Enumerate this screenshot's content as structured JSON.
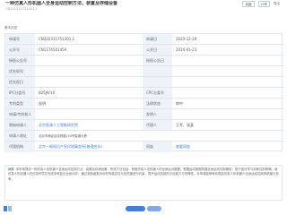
{
  "header": {
    "title": "一种仿真人形机器人全身运动控制方法、装置及存储设备",
    "subtitle": "CN202311751201.1",
    "actions": [
      "收藏",
      "分享",
      "导出"
    ]
  },
  "section": {
    "title": "基本信息"
  },
  "rows": [
    {
      "l1": "申请号",
      "v1": "CN202311751201.1",
      "l2": "申请日",
      "v2": "2023-12-19"
    },
    {
      "l1": "公开号",
      "v1": "CN117450145A",
      "l2": "公开日",
      "v2": "2024-01-23"
    },
    {
      "l1": "授权公告号",
      "v1": "",
      "l2": "授权公告日",
      "v2": ""
    },
    {
      "l1": "优先权号",
      "v1": "",
      "l2": "",
      "v2": ""
    },
    {
      "l1": "优先权日",
      "v1": "",
      "l2": "",
      "v2": ""
    },
    {
      "l1": "IPC分类号",
      "v1": "B25J9/16",
      "l2": "CPC分类号",
      "v2": ""
    },
    {
      "l1": "专利类型",
      "v1": "发明",
      "l2": "法律状态",
      "v2": "审中"
    },
    {
      "l1": "申请/专利权人",
      "v1": "",
      "l2": "发明人",
      "v2": ""
    },
    {
      "l1": "原始申请人",
      "v1": "北京智源人工智能研究院",
      "l2": "代理人",
      "v2": "王军、张某"
    },
    {
      "l1": "申请人地址",
      "v1": "北京市海淀区成府路150号智源大厦",
      "l2": "",
      "v2": ""
    },
    {
      "l1": "代理机构",
      "v1": "北京一格知识产权代理事务所(普通合伙)",
      "l2": "同族",
      "v2": "查看同族"
    }
  ],
  "abstract": {
    "label": "摘要",
    "text": "本申请提供一种仿真人形机器人全身运动控制方法、装置及存储设备，所述方法包括：获取仿真人形机器人的全身运动数据；根据运动数据构建全身运动控制模型；基于强化学习训练控制策略，使仿真人形机器人在仿真环境中完成多种复杂全身动作；通过奖励函数对动作的稳定性与自然度进行约束，提升运动控制的泛化能力与鲁棒性。本申请能够有效提高仿真人形机器人全身运动控制的精度与效率。"
  },
  "footer": {
    "brand_icon": "logo-icon"
  }
}
